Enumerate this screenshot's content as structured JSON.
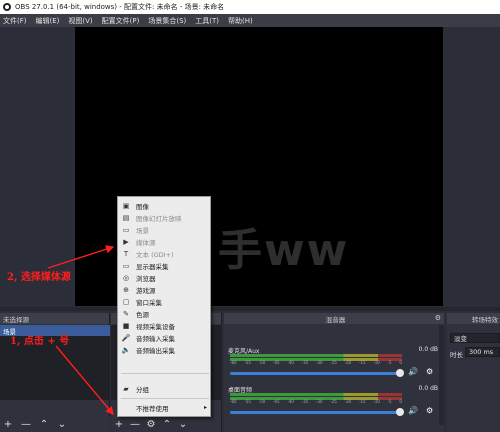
{
  "window": {
    "title": "OBS 27.0.1 (64-bit, windows) - 配置文件: 未命名 - 场景: 未命名"
  },
  "menubar": [
    "文件(F)",
    "编辑(E)",
    "视图(V)",
    "配置文件(P)",
    "场景集合(S)",
    "工具(T)",
    "帮助(H)"
  ],
  "annotations": {
    "step1": "1, 点击 + 号",
    "step2": "2, 选择媒体源"
  },
  "watermark": "手ww",
  "scenes": {
    "header": "未选择源",
    "items": [
      "场景"
    ]
  },
  "mixer": {
    "header": "混音器",
    "channels": [
      {
        "name": "麦克风/Aux",
        "db": "0.0 dB",
        "ticks": [
          "-60",
          "-55",
          "-50",
          "-45",
          "-40",
          "-35",
          "-30",
          "-25",
          "-20",
          "-15",
          "-10",
          "-5",
          "0"
        ]
      },
      {
        "name": "桌面音频",
        "db": "0.0 dB",
        "ticks": [
          "-60",
          "-55",
          "-50",
          "-45",
          "-40",
          "-35",
          "-30",
          "-25",
          "-20",
          "-15",
          "-10",
          "-5",
          "0"
        ]
      }
    ]
  },
  "transitions": {
    "header": "转场特效",
    "type": "淡变",
    "duration_label": "时长",
    "duration": "300 ms"
  },
  "context_menu": {
    "items": [
      {
        "label": "图像",
        "icon": "image-icon",
        "enabled": true
      },
      {
        "label": "图像幻灯片放映",
        "icon": "slideshow-icon",
        "enabled": false
      },
      {
        "label": "场景",
        "icon": "scene-icon",
        "enabled": false
      },
      {
        "label": "媒体源",
        "icon": "play-icon",
        "enabled": false
      },
      {
        "label": "文本 (GDI+)",
        "icon": "text-icon",
        "enabled": false
      },
      {
        "label": "显示器采集",
        "icon": "monitor-icon",
        "enabled": true
      },
      {
        "label": "浏览器",
        "icon": "globe-icon",
        "enabled": true
      },
      {
        "label": "游戏源",
        "icon": "gamepad-icon",
        "enabled": true
      },
      {
        "label": "窗口采集",
        "icon": "window-icon",
        "enabled": true
      },
      {
        "label": "色源",
        "icon": "brush-icon",
        "enabled": true
      },
      {
        "label": "视频采集设备",
        "icon": "camera-icon",
        "enabled": true
      },
      {
        "label": "音频输入采集",
        "icon": "microphone-icon",
        "enabled": true
      },
      {
        "label": "音频输出采集",
        "icon": "speaker-icon",
        "enabled": true
      },
      {
        "label": "分组",
        "icon": "folder-icon",
        "enabled": true
      },
      {
        "label": "不推荐使用",
        "icon": "",
        "enabled": true
      }
    ]
  },
  "colors": {
    "annotation": "#ff1e1e",
    "selection": "#3a5c9a",
    "slider": "#3b7fd6"
  }
}
